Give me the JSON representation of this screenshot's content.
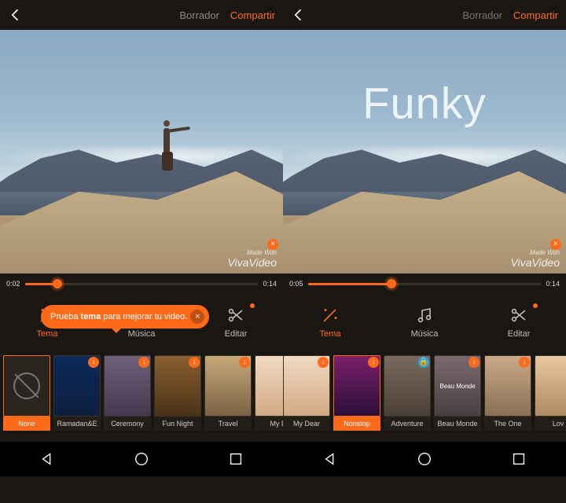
{
  "header": {
    "draft": "Borrador",
    "share": "Compartir"
  },
  "watermark": {
    "small": "Made With",
    "brand": "VivaVideo"
  },
  "overlay_right": "Funky",
  "tooltip": {
    "prefix": "Prueba ",
    "bold": "tema",
    "suffix": " para mejorar tu video."
  },
  "tabs": {
    "tema": "Tema",
    "musica": "Música",
    "editar": "Editar"
  },
  "left": {
    "time_current": "0:02",
    "time_total": "0:14",
    "themes": [
      {
        "key": "none",
        "label": "None",
        "badge": null,
        "bg": "#2a251f",
        "selected": true,
        "hasNone": true
      },
      {
        "key": "ramadan",
        "label": "Ramadan&E",
        "badge": "down",
        "bg": "linear-gradient(#0b2a5a,#0e1e3e)",
        "selected": false
      },
      {
        "key": "ceremony",
        "label": "Ceremony",
        "badge": "down",
        "bg": "linear-gradient(#6e5f7a,#45384f)",
        "selected": false
      },
      {
        "key": "funnight",
        "label": "Fun Night",
        "badge": "down",
        "bg": "linear-gradient(#8a5f2f,#4a3218)",
        "selected": false
      },
      {
        "key": "travel",
        "label": "Travel",
        "badge": "down",
        "bg": "linear-gradient(#c7a87a,#7a6243)",
        "selected": false
      },
      {
        "key": "mydear1",
        "label": "My D",
        "badge": "lock",
        "bg": "linear-gradient(#f0d9c2,#d3a984)",
        "selected": false
      }
    ]
  },
  "right": {
    "time_current": "0:05",
    "time_total": "0:14",
    "themes": [
      {
        "key": "mydear2",
        "label": "My Dear",
        "badge": "down",
        "bg": "linear-gradient(#f0d9c2,#d3a984)",
        "selected": false
      },
      {
        "key": "nonstop",
        "label": "Nonstop",
        "badge": "down",
        "bg": "linear-gradient(#7a1f6a,#2a0f3a)",
        "selected": true
      },
      {
        "key": "adventure",
        "label": "Adventure",
        "badge": "lock",
        "bg": "linear-gradient(#7a6a5f,#4a3f36)",
        "selected": false
      },
      {
        "key": "beaumonde",
        "label": "Beau Monde",
        "badge": "down",
        "bg": "linear-gradient(#7a6a6f,#4a3f44)",
        "selected": false,
        "overlay": "Beau Monde"
      },
      {
        "key": "theone",
        "label": "The One",
        "badge": "down",
        "bg": "linear-gradient(#caa98a,#8a6f54)",
        "selected": false
      },
      {
        "key": "lov",
        "label": "Lov",
        "badge": "down",
        "bg": "linear-gradient(#e8c7a0,#b08a60)",
        "selected": false
      }
    ]
  }
}
